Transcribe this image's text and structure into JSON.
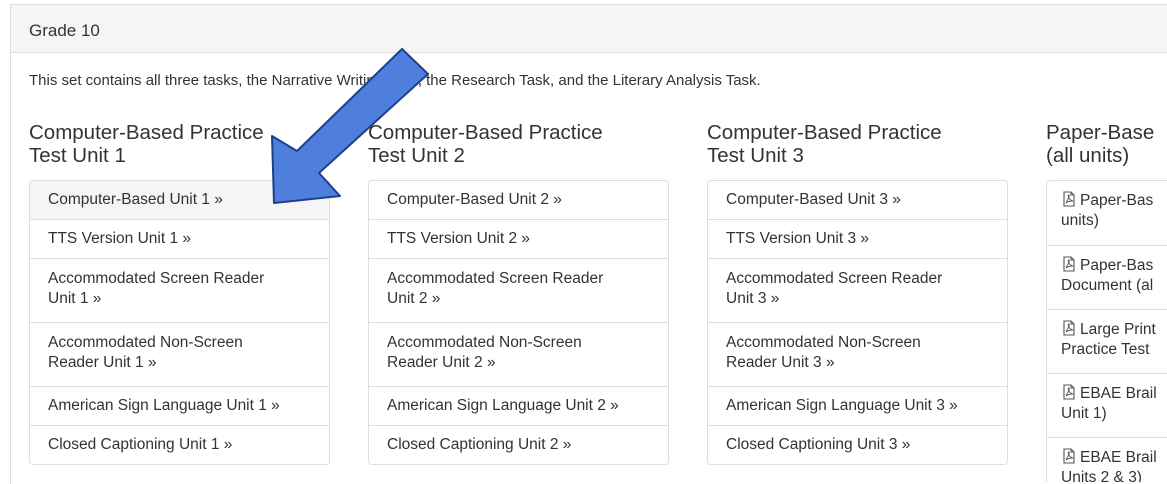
{
  "panel": {
    "heading": "Grade 10",
    "intro": "This set contains all three tasks, the Narrative Writing Task, the Research Task, and the Literary Analysis Task."
  },
  "columns": [
    {
      "title_line1": "Computer-Based Practice",
      "title_line2": "Test Unit 1",
      "items": [
        {
          "line1": "Computer-Based Unit 1 »",
          "line2": ""
        },
        {
          "line1": "TTS Version Unit 1 »",
          "line2": ""
        },
        {
          "line1": "Accommodated Screen Reader",
          "line2": "Unit 1 »"
        },
        {
          "line1": "Accommodated Non-Screen",
          "line2": "Reader Unit 1 »"
        },
        {
          "line1": "American Sign Language Unit 1 »",
          "line2": ""
        },
        {
          "line1": "Closed Captioning Unit 1 »",
          "line2": ""
        }
      ]
    },
    {
      "title_line1": "Computer-Based Practice",
      "title_line2": "Test Unit 2",
      "items": [
        {
          "line1": "Computer-Based Unit 2 »",
          "line2": ""
        },
        {
          "line1": "TTS Version Unit 2 »",
          "line2": ""
        },
        {
          "line1": "Accommodated Screen Reader",
          "line2": "Unit 2 »"
        },
        {
          "line1": "Accommodated Non-Screen",
          "line2": "Reader Unit 2 »"
        },
        {
          "line1": "American Sign Language Unit 2 »",
          "line2": ""
        },
        {
          "line1": "Closed Captioning Unit 2 »",
          "line2": ""
        }
      ]
    },
    {
      "title_line1": "Computer-Based Practice",
      "title_line2": "Test Unit 3",
      "items": [
        {
          "line1": "Computer-Based Unit 3 »",
          "line2": ""
        },
        {
          "line1": "TTS Version Unit 3 »",
          "line2": ""
        },
        {
          "line1": "Accommodated Screen Reader",
          "line2": "Unit 3 »"
        },
        {
          "line1": "Accommodated Non-Screen",
          "line2": "Reader Unit 3 »"
        },
        {
          "line1": "American Sign Language Unit 3 »",
          "line2": ""
        },
        {
          "line1": "Closed Captioning Unit 3 »",
          "line2": ""
        }
      ]
    },
    {
      "title_line1": "Paper-Base",
      "title_line2": "(all units)",
      "items": [
        {
          "line1": "Paper-Bas",
          "line2": "units)"
        },
        {
          "line1": "Paper-Bas",
          "line2": "Document (al"
        },
        {
          "line1": "Large Print",
          "line2": "Practice Test"
        },
        {
          "line1": "EBAE Brail",
          "line2": "Unit 1)"
        },
        {
          "line1": "EBAE Brail",
          "line2": "Units 2 & 3)"
        }
      ]
    }
  ],
  "icons": {
    "pdf": "pdf-file-icon",
    "annotation": "pointer-arrow-annotation"
  },
  "colors": {
    "arrow_fill": "#4f7fdc",
    "arrow_stroke": "#1f3f8c",
    "active_item": "#f5f5f5"
  }
}
